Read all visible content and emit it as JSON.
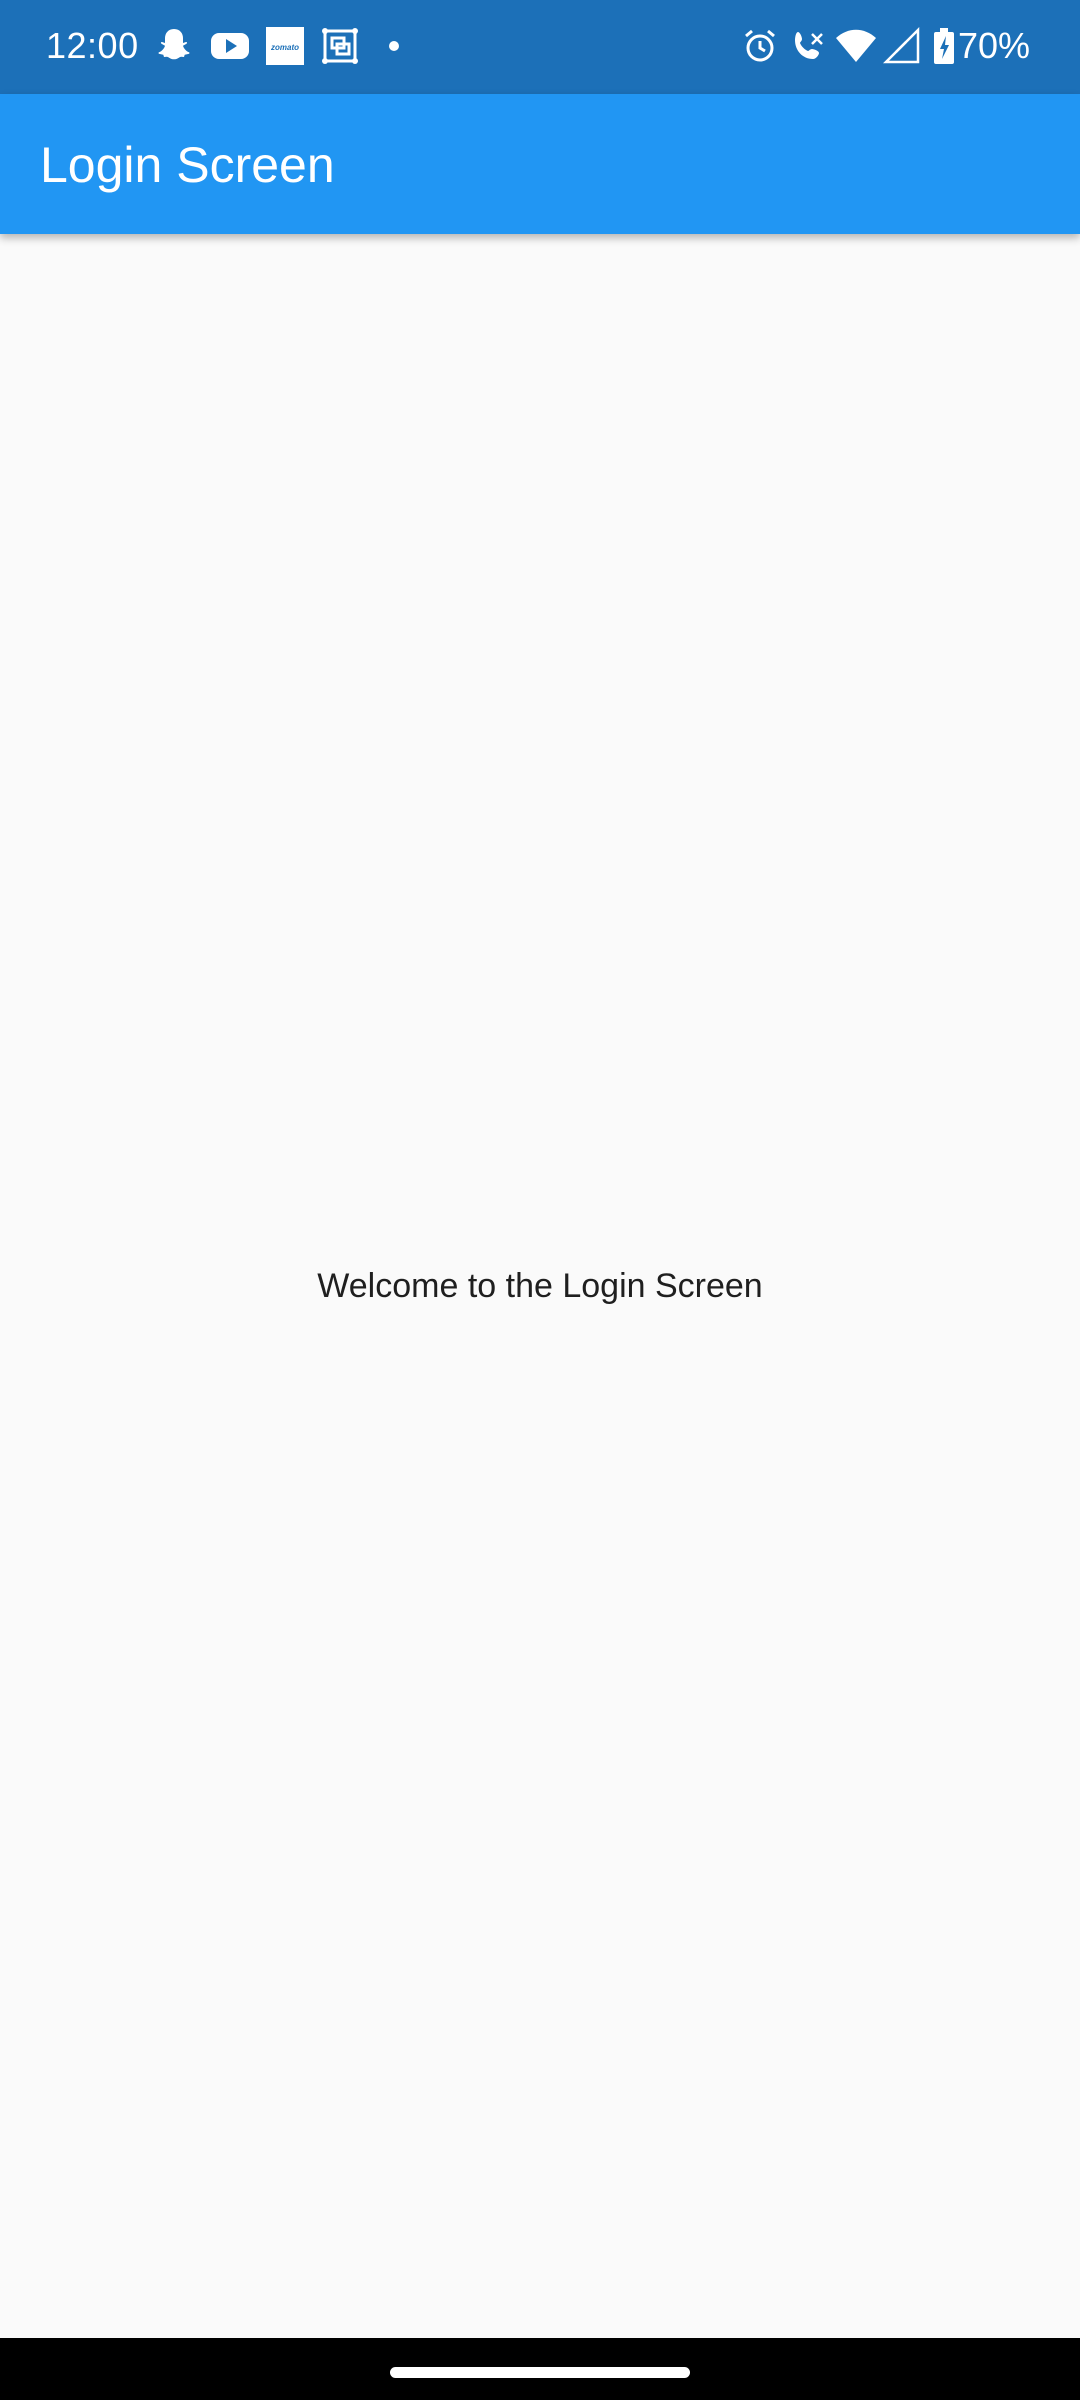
{
  "status_bar": {
    "time": "12:00",
    "battery_percent": "70%",
    "left_icons": [
      "snapchat-icon",
      "youtube-icon",
      "zomato-icon",
      "screenshot-icon",
      "dot-icon"
    ],
    "zomato_text": "zomato",
    "right_icons": [
      "alarm-icon",
      "call-icon",
      "wifi-icon",
      "signal-icon",
      "battery-icon"
    ],
    "background_color": "#1c70b8"
  },
  "app_bar": {
    "title": "Login Screen",
    "color": "#2196f3"
  },
  "main": {
    "welcome_text": "Welcome to the Login Screen"
  }
}
